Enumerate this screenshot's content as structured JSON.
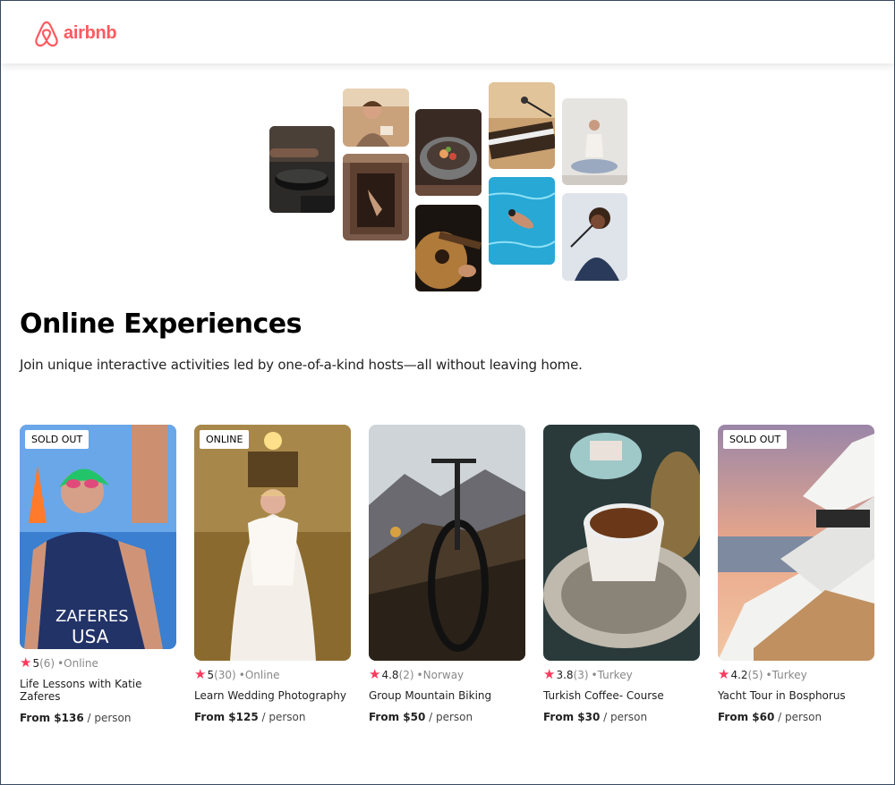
{
  "brand": {
    "name": "airbnb",
    "color": "#FF5A5F"
  },
  "hero": {
    "title": "Online Experiences",
    "subtitle": "Join unique interactive activities led by one-of-a-kind hosts—all without leaving home.",
    "images": [
      "cooking-pan",
      "woman-smiling",
      "woman-in-doorway",
      "food-bowl",
      "guitar",
      "keyboard-mic",
      "swimmer-pool",
      "yoga-woman",
      "singer"
    ]
  },
  "colors": {
    "star": "#FE385C",
    "text": "#222222"
  },
  "cards": [
    {
      "badge": "SOLD OUT",
      "rating": "5",
      "count": "(6)",
      "location": "•Online",
      "title": "Life Lessons with Katie Zaferes",
      "price": "From $136",
      "per": " / person",
      "image": "triathlete"
    },
    {
      "badge": "ONLINE",
      "rating": "5",
      "count": "(30)",
      "location": "•Online",
      "title": "Learn Wedding Photography",
      "price": "From $125",
      "per": " / person",
      "image": "bride"
    },
    {
      "badge": "",
      "rating": "4.8",
      "count": "(2)",
      "location": "•Norway",
      "title": "Group Mountain Biking",
      "price": "From $50",
      "per": " / person",
      "image": "mountain-bike"
    },
    {
      "badge": "",
      "rating": "3.8",
      "count": "(3)",
      "location": "•Turkey",
      "title": "Turkish Coffee- Course",
      "price": "From $30",
      "per": " / person",
      "image": "turkish-coffee"
    },
    {
      "badge": "SOLD OUT",
      "rating": "4.2",
      "count": "(5)",
      "location": "•Turkey",
      "title": "Yacht Tour in Bosphorus",
      "price": "From $60",
      "per": " / person",
      "image": "yacht"
    }
  ]
}
